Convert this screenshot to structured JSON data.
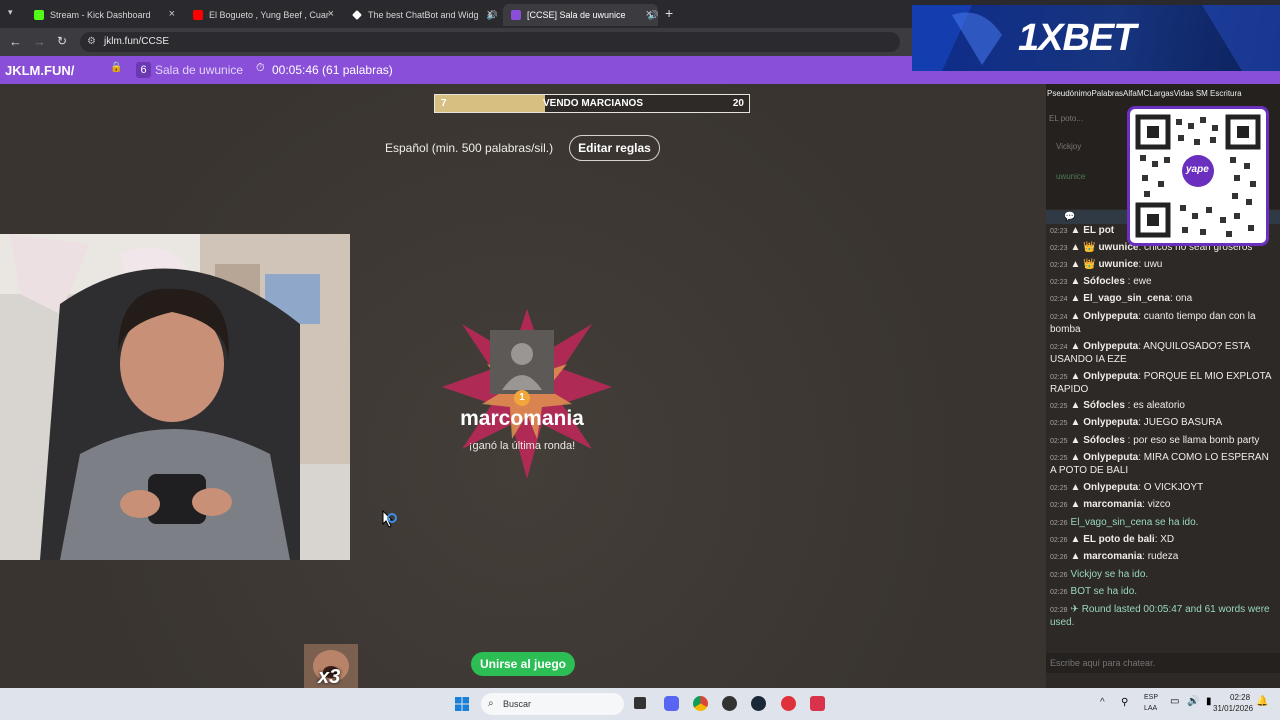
{
  "browser": {
    "tabs": [
      {
        "label": "Stream - Kick Dashboard",
        "fav_color": "#53fc18"
      },
      {
        "label": "El Bogueto , Yung Beef , Cuando",
        "fav_color": "#ff0000"
      },
      {
        "label": "The best ChatBot and Widg",
        "fav_color": "#ffffff"
      },
      {
        "label": "[CCSE] Sala de uwunice",
        "fav_color": "#8a4fd8"
      }
    ],
    "new_tab": "+",
    "url": "jklm.fun/CCSE"
  },
  "site": {
    "brand": "JKLM.FUN/",
    "players_count": "6",
    "room_name": "Sala de uwunice",
    "timer": "00:05:46 (61 palabras)"
  },
  "game": {
    "word_left": "7",
    "word": "VENDO MARCIANOS",
    "word_right": "20",
    "word_progress": 0.35,
    "rules_text": "Español (min. 500 palabras/sil.)",
    "edit_rules_label": "Editar reglas",
    "winner_name": "marcomania",
    "winner_subtitle": "¡ganó la última ronda!",
    "winner_badge": "1",
    "join_label": "Unirse al juego",
    "emote_label": "x3"
  },
  "scoreboard": {
    "headers": "PseudónimoPalabrasAlfaMCLargasVidas SM Escritura",
    "rows": [
      "EL poto...",
      "Vickjoy",
      "uwunice"
    ]
  },
  "chat": {
    "messages": [
      {
        "time": "02:23",
        "user": "EL pot",
        "text": ""
      },
      {
        "time": "02:23",
        "user": "uwunice",
        "text": ": chicos no sean groseros"
      },
      {
        "time": "02:23",
        "user": "uwunice",
        "text": ": uwu"
      },
      {
        "time": "02:23",
        "user": "Sófocles",
        "text": " : ewe"
      },
      {
        "time": "02:24",
        "user": "El_vago_sin_cena",
        "text": ": ona"
      },
      {
        "time": "02:24",
        "user": "Onlypeputa",
        "text": ": cuanto tiempo dan con la bomba"
      },
      {
        "time": "02:24",
        "user": "Onlypeputa",
        "text": ": ANQUILOSADO? ESTA USANDO IA EZE"
      },
      {
        "time": "02:25",
        "user": "Onlypeputa",
        "text": ": PORQUE EL MIO EXPLOTA RAPIDO"
      },
      {
        "time": "02:25",
        "user": "Sófocles",
        "text": " : es aleatorio"
      },
      {
        "time": "02:25",
        "user": "Onlypeputa",
        "text": ": JUEGO BASURA"
      },
      {
        "time": "02:25",
        "user": "Sófocles",
        "text": " : por eso se llama bomb party"
      },
      {
        "time": "02:25",
        "user": "Onlypeputa",
        "text": ": MIRA COMO LO ESPERAN A POTO DE BALI"
      },
      {
        "time": "02:25",
        "user": "Onlypeputa",
        "text": ": O VICKJOYT"
      },
      {
        "time": "02:26",
        "user": "marcomania",
        "text": ": vizco"
      },
      {
        "time": "02:26",
        "user": "",
        "text": "El_vago_sin_cena se ha ido."
      },
      {
        "time": "02:26",
        "user": "EL poto de bali",
        "text": ": XD"
      },
      {
        "time": "02:26",
        "user": "marcomania",
        "text": ": rudeza"
      },
      {
        "time": "02:26",
        "user": "",
        "text": "Vickjoy se ha ido."
      },
      {
        "time": "02:26",
        "user": "",
        "text": "BOT se ha ido."
      },
      {
        "time": "02:28",
        "user": "",
        "text": "Round lasted 00:05:47 and 61 words were used."
      }
    ],
    "input_placeholder": "Escribe aquí para chatear."
  },
  "ad": {
    "brand": "1XBET"
  },
  "qr": {
    "label": "yape"
  },
  "taskbar": {
    "search_placeholder": "Buscar",
    "lang_top": "ESP",
    "lang_bottom": "LAA",
    "time": "02:28",
    "date": "31/01/2026"
  }
}
